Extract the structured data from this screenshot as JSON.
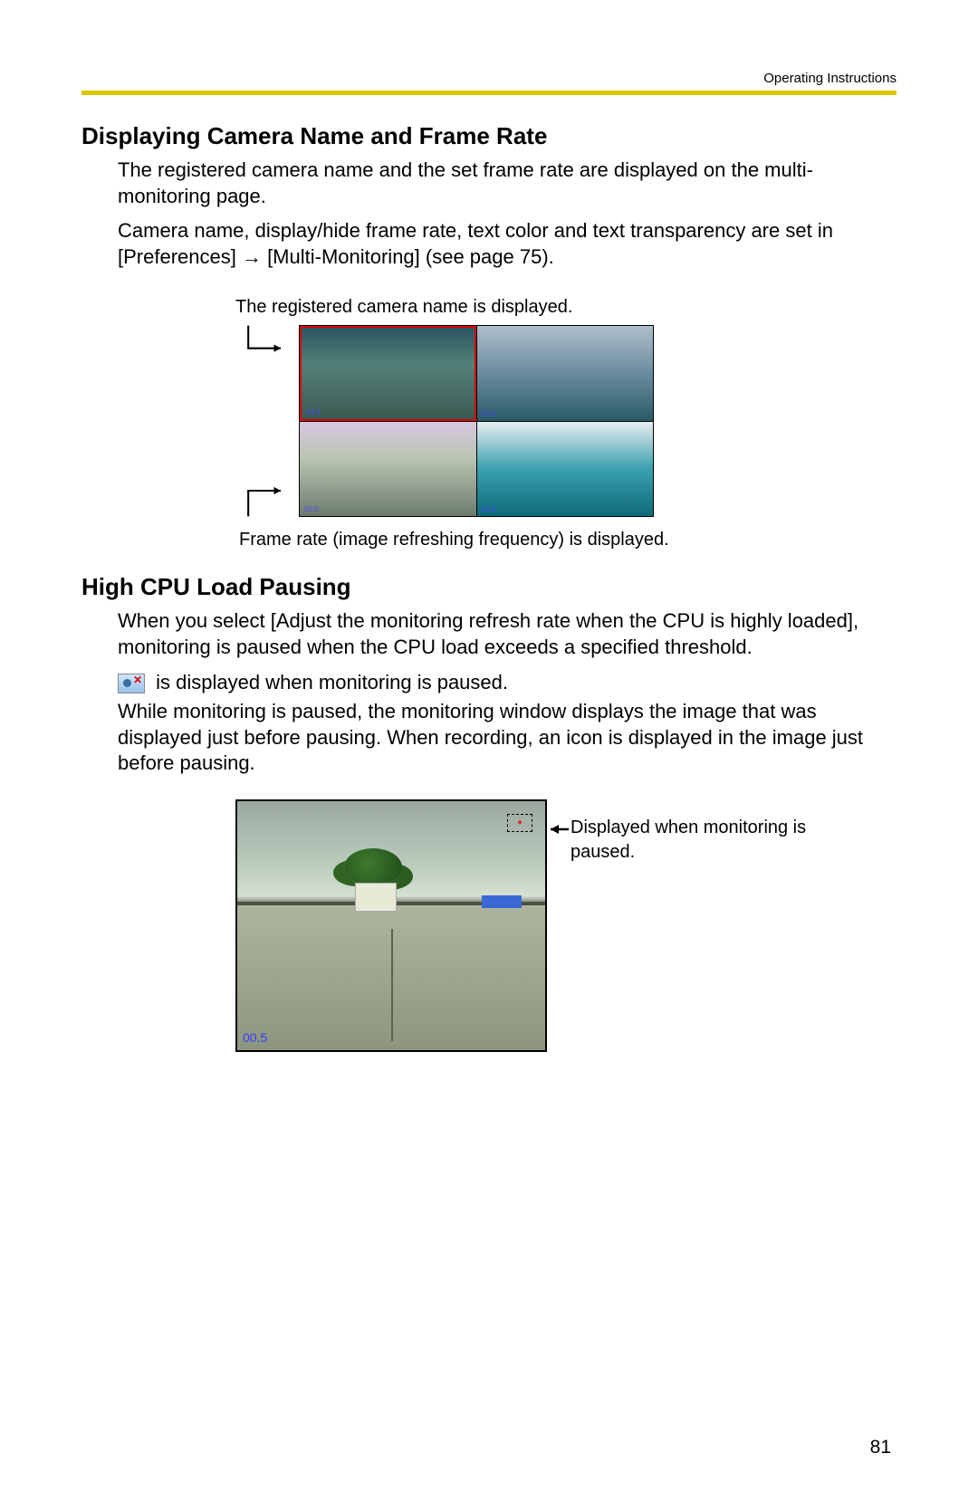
{
  "header": {
    "label": "Operating Instructions"
  },
  "section1": {
    "title": "Displaying Camera Name and Frame Rate",
    "p1": "The registered camera name and the set frame rate are displayed on the multi-monitoring page.",
    "p2": " Camera name, display/hide frame rate, text color and text transparency are set in [Preferences] → [Multi-Monitoring] (see page 75).",
    "caption_top": "The registered camera name is displayed.",
    "caption_bottom": "Frame rate (image refreshing frequency) is displayed.",
    "cams": {
      "c1": {
        "fr": "04.3"
      },
      "c2": {
        "fr": "02.0"
      },
      "c3": {
        "fr": "02.0"
      },
      "c4": {
        "fr": "02.0"
      }
    }
  },
  "section2": {
    "title": "High CPU Load Pausing",
    "p1": "When you select [Adjust the monitoring refresh rate when the CPU is highly loaded], monitoring is paused when the CPU load exceeds a specified threshold.",
    "p2_after_icon": " is displayed when monitoring is paused.",
    "p3": "While monitoring is paused, the monitoring window displays the image that was displayed just before pausing. When recording, an icon is displayed in the image just before pausing.",
    "callout": "Displayed when monitoring is paused.",
    "fr": "00.5"
  },
  "page_number": "81"
}
